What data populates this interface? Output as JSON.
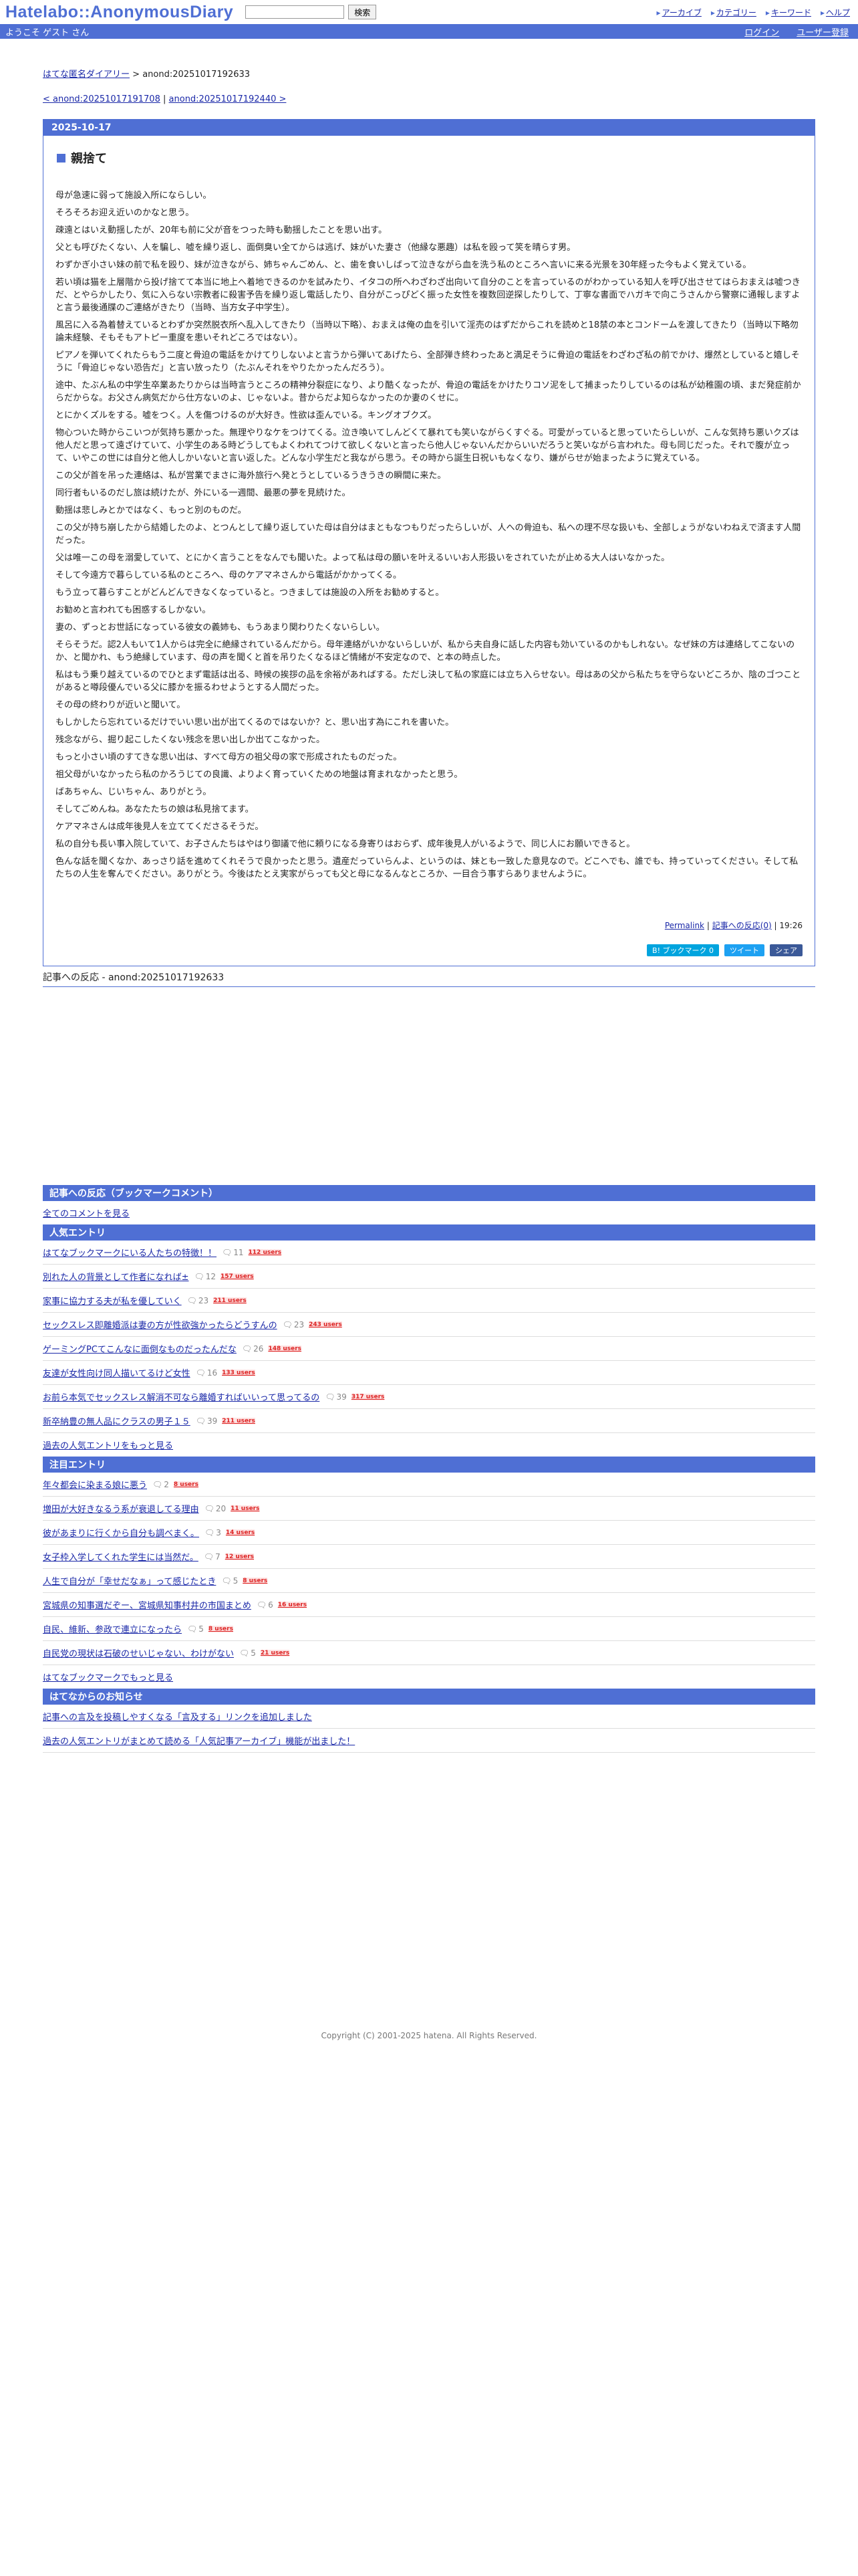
{
  "header": {
    "logo": "Hatelabo::AnonymousDiary",
    "search_button": "検索",
    "links": [
      "アーカイブ",
      "カテゴリー",
      "キーワード",
      "ヘルプ"
    ]
  },
  "bar": {
    "welcome": "ようこそ ゲスト さん",
    "login": "ログイン",
    "register": "ユーザー登録"
  },
  "breadcrumb": {
    "home": "はてな匿名ダイアリー",
    "sep": ">",
    "current": "anond:20251017192633"
  },
  "prevnext": {
    "prev": "< anond:20251017191708",
    "sep": "|",
    "next": "anond:20251017192440 >"
  },
  "article": {
    "date": "2025-10-17",
    "title": "親捨て",
    "paragraphs": [
      "母が急速に弱って施設入所にならしい。",
      "そろそろお迎え近いのかなと思う。",
      "疎遠とはいえ動揺したが、20年も前に父が音をつった時も動揺したことを思い出す。",
      "父とも呼びたくない、人を騙し、嘘を繰り返し、面倒臭い全てからは逃げ、妹がいた妻さ（他縁な悪趣）は私を殴って笑を晴らす男。",
      "わずかぎ小さい妹の前で私を殴り、妹が泣きながら、姉ちゃんごめん、と、歯を食いしばって泣きながら血を洗う私のところへ言いに来る光景を30年経った今もよく覚えている。",
      "若い頃は猫を上層階から投げ捨てて本当に地上へ着地できるのかを試みたり、イタコの所へわざわざ出向いて自分のことを言っているのがわかっている知人を呼び出させてはらおまえは嘘つきだ、とやらかしたり、気に入らない宗教者に殺害予告を繰り返し電話したり、自分がこっぴどく振った女性を複数回逆探したりして、丁寧な書面でハガキで向こうさんから警察に通報しますよと言う最後通牒のご連絡がきたり（当時、当方女子中学生）。",
      "風呂に入る為着替えているとわずか突然脱衣所へ乱入してきたり（当時以下略）、おまえは俺の血を引いて淫売のはずだからこれを読めと18禁の本とコンドームを渡してきたり（当時以下略勿論未経験、そもそもアトピー重度を患いそれどころではない）。",
      "ピアノを弾いてくれたらもう二度と骨迫の電話をかけてりしないよと言うから弾いてあげたら、全部弾き終わったあと満足そうに骨迫の電話をわざわざ私の前でかけ、爆然としていると嬉しそうに「骨迫じゃない恐告だ」と言い放ったり（たぶんそれをやりたかったんだろう）。",
      "途中、たぶん私の中学生卒業あたりからは当時言うところの精神分裂症になり、より酷くなったが、骨迫の電話をかけたりコソ泥をして捕まったりしているのは私が幼稚園の頃、まだ発症前からだからな。お父さん病気だから仕方ないのよ、じゃないよ。昔からだよ知らなかったのか妻のくせに。",
      "とにかくズルをする。嘘をつく。人を傷つけるのが大好き。性欲は歪んでいる。キングオブクズ。",
      "物心ついた時からこいつが気持ち悪かった。無理やりなケをつけてくる。泣き喚いてしんどくて暴れても笑いながらくすぐる。可愛がっていると思っていたらしいが、こんな気持ち悪いクズは他人だと思って遠ざけていて、小学生のある時どうしてもよくわれてつけて欲しくないと言ったら他人じゃないんだからいいだろうと笑いながら言われた。母も同じだった。それで腹が立って、いやこの世には自分と他人しかいないと言い返した。どんな小学生だと我ながら思う。その時から誕生日祝いもなくなり、嫌がらせが始まったように覚えている。",
      "この父が首を吊った連絡は、私が営業でまさに海外旅行へ発とうとしているうきうきの瞬間に来た。",
      "同行者もいるのだし旅は続けたが、外にいる一週間、最悪の夢を見続けた。",
      "動揺は悲しみとかではなく、もっと別のものだ。",
      "この父が持ち崩したから結婚したのよ、とつんとして繰り返していた母は自分はまともなつもりだったらしいが、人への骨迫も、私への理不尽な扱いも、全部しょうがないわねえで済ます人間だった。",
      "父は唯一この母を溺愛していて、とにかく言うことをなんでも聞いた。よって私は母の願いを叶えるいいお人形扱いをされていたが止める大人はいなかった。",
      "そして今遠方で暮らしている私のところへ、母のケアマネさんから電話がかかってくる。",
      "もう立って暮らすことがどんどんできなくなっていると。つきましては施設の入所をお勧めすると。",
      "お勧めと言われても困惑するしかない。",
      "妻の、ずっとお世話になっている彼女の義姉も、もうあまり関わりたくないらしい。",
      "そらそうだ。認2人もいて1人からは完全に絶縁されているんだから。母年連絡がいかないらしいが、私から夫自身に話した内容も効いているのかもしれない。なぜ妹の方は連絡してこないのか、と聞かれ、もう絶縁しています、母の声を聞くと首を吊りたくなるほど情緒が不安定なので、と本の時点した。",
      "私はもう乗り越えているのでひとまず電話は出る、時候の挨拶の品を余裕があればする。ただし決して私の家庭には立ち入らせない。母はあの父から私たちを守らないどころか、陰のゴつことがあると噂段優んでいる父に膝かを振るわせようとする人間だった。",
      "その母の終わりが近いと聞いて。",
      "もしかしたら忘れているだけでいい思い出が出てくるのではないか？と、思い出す為にこれを書いた。",
      "残念ながら、掘り起こしたくない残念を思い出しか出てこなかった。",
      "もっと小さい頃のすてきな思い出は、すべて母方の祖父母の家で形成されたものだった。",
      "祖父母がいなかったら私のかろうじての良識、よりよく育っていくための地盤は育まれなかったと思う。",
      "ばあちゃん、じいちゃん、ありがとう。",
      "そしてごめんね。あなたたちの娘は私見捨てます。",
      "ケアマネさんは成年後見人を立ててくださるそうだ。",
      "私の自分も長い事入院していて、お子さんたちはやはり御議で他に頼りになる身寄りはおらず、成年後見人がいるようで、同じ人にお願いできると。",
      "色んな話を聞くなか、あっさり話を進めてくれそうで良かったと思う。遺産だっていらんよ、というのは、妹とも一致した意見なので。どこへでも、誰でも、持っていってください。そして私たちの人生を奪んでください。ありがとう。今後はたとえ実家がらっても父と母になるんなところか、一目合う事すらありませんように。"
    ],
    "permalink": "Permalink",
    "meta_sep": "|",
    "reaction_link": "記事への反応(0)",
    "meta_sep2": "|",
    "time": "19:26",
    "share": {
      "hatena": "B! ブックマーク 0",
      "twitter": "ツイート",
      "facebook": "シェア"
    }
  },
  "reactions_label": "記事への反応 - anond:20251017192633",
  "bookmark_section": {
    "title": "記事への反応（ブックマークコメント）",
    "all_comments": "全てのコメントを見る"
  },
  "popular": {
    "title": "人気エントリ",
    "items": [
      {
        "text": "はてなブックマークにいる人たちの特徴！！",
        "comments": "11",
        "users": "112 users"
      },
      {
        "text": "別れた人の背景として作者になれば±",
        "comments": "12",
        "users": "157 users"
      },
      {
        "text": "家事に協力する夫が私を優していく",
        "comments": "23",
        "users": "211 users"
      },
      {
        "text": "セックスレス即離婚派は妻の方が性欲強かったらどうすんの",
        "comments": "23",
        "users": "243 users"
      },
      {
        "text": "ゲーミングPCてこんなに面倒なものだったんだな",
        "comments": "26",
        "users": "148 users"
      },
      {
        "text": "友達が女性向け同人描いてるけど女性",
        "comments": "16",
        "users": "133 users"
      },
      {
        "text": "お前ら本気でセックスレス解消不可なら離婚すればいいって思ってるの",
        "comments": "39",
        "users": "317 users"
      },
      {
        "text": "新卒納豊の無人品にクラスの男子１５",
        "comments": "39",
        "users": "211 users"
      }
    ],
    "more": "過去の人気エントリをもっと見る"
  },
  "attention": {
    "title": "注目エントリ",
    "items": [
      {
        "text": "年々都会に染まる娘に悪う",
        "comments": "2",
        "users": "8 users"
      },
      {
        "text": "増田が大好きなるう系が衰退してる理由",
        "comments": "20",
        "users": "11 users"
      },
      {
        "text": "彼があまりに行くから自分も調べまく。",
        "comments": "3",
        "users": "14 users"
      },
      {
        "text": "女子枠入学してくれた学生には当然だ。",
        "comments": "7",
        "users": "12 users"
      },
      {
        "text": "人生で自分が「幸せだなぁ」って感じたとき",
        "comments": "5",
        "users": "8 users"
      },
      {
        "text": "宮城県の知事選だぞー、宮城県知事村井の市国まとめ",
        "comments": "6",
        "users": "16 users"
      },
      {
        "text": "自民、維新、参政で連立になったら",
        "comments": "5",
        "users": "8 users"
      },
      {
        "text": "自民党の現状は石破のせいじゃない、わけがない",
        "comments": "5",
        "users": "21 users"
      }
    ],
    "more": "はてなブックマークでもっと見る"
  },
  "news": {
    "title": "はてなからのお知らせ",
    "items": [
      "記事への言及を投稿しやすくなる「言及する」リンクを追加しました",
      "過去の人気エントリがまとめて読める「人気記事アーカイブ」機能が出ました！"
    ]
  },
  "footer": "Copyright (C) 2001-2025 hatena. All Rights Reserved."
}
